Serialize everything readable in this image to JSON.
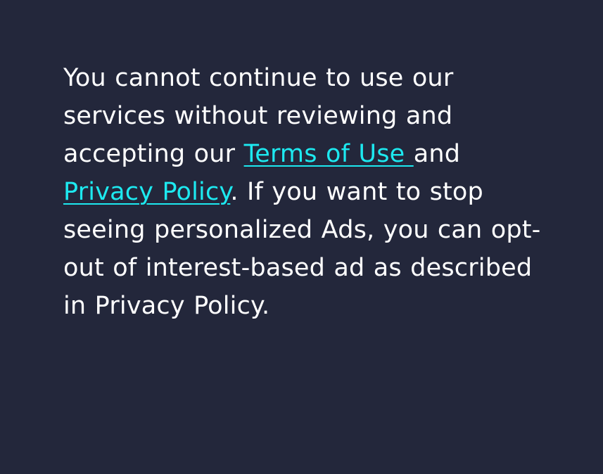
{
  "notice": {
    "text_1": "You cannot continue to use our services without reviewing and accepting our ",
    "terms_link": "Terms of Use ",
    "text_2": "and ",
    "privacy_link": "Privacy Policy",
    "text_3": ". If you want to stop seeing personalized Ads, you can opt-out of interest-based ad as described in Privacy Policy."
  },
  "colors": {
    "background": "#23273b",
    "text": "#ffffff",
    "link": "#1de9f0"
  }
}
